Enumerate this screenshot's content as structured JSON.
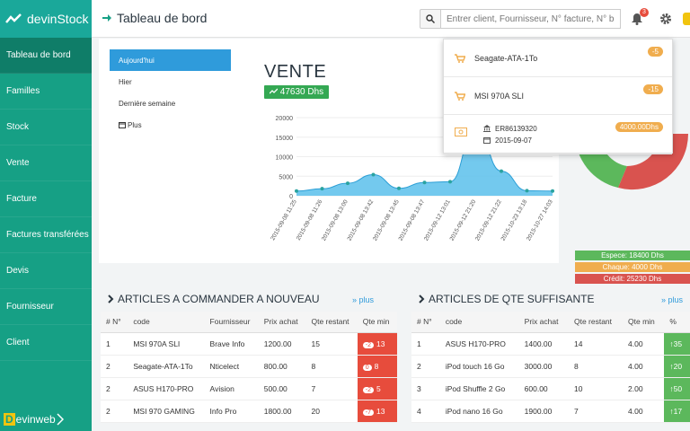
{
  "brand": {
    "name": "devinStock"
  },
  "sidebar": {
    "items": [
      {
        "label": "Tableau de bord"
      },
      {
        "label": "Familles"
      },
      {
        "label": "Stock"
      },
      {
        "label": "Vente"
      },
      {
        "label": "Facture"
      },
      {
        "label": "Factures transférées"
      },
      {
        "label": "Devis"
      },
      {
        "label": "Fournisseur"
      },
      {
        "label": "Client"
      }
    ],
    "footer_logo_d": "D",
    "footer_logo_text": "evinweb"
  },
  "header": {
    "title": "Tableau de bord",
    "search_placeholder": "Entrer client, Fournisseur, N° facture, N° b",
    "notif_count": "3"
  },
  "filters": [
    {
      "label": "Aujourd'hui"
    },
    {
      "label": "Hier"
    },
    {
      "label": "Dernière semaine"
    },
    {
      "label": "Plus"
    }
  ],
  "vente": {
    "title": "VENTE",
    "total": "47630 Dhs"
  },
  "chart_data": {
    "type": "area",
    "x": [
      "2015-09-08 11:25",
      "2015-09-08 11:26",
      "2015-09-08 13:00",
      "2015-09-08 13:42",
      "2015-09-08 13:45",
      "2015-09-08 13:47",
      "2015-09-12 13:01",
      "2015-09-12 21:20",
      "2015-09-12 21:22",
      "2015-10-23 13:18",
      "2015-10-27 14:03"
    ],
    "values": [
      1200,
      1800,
      3200,
      5400,
      1900,
      3400,
      3600,
      17500,
      6300,
      1300,
      1200
    ],
    "yticks": [
      0,
      5000,
      10000,
      15000,
      20000
    ],
    "ylim": [
      0,
      20000
    ],
    "color": "#5bc0eb"
  },
  "donut": {
    "legend": [
      {
        "label": "Espece: 18400 Dhs",
        "color": "#5cb85c"
      },
      {
        "label": "Chaque: 4000 Dhs",
        "color": "#f0ad4e"
      },
      {
        "label": "Crédit: 25230 Dhs",
        "color": "#d9534f"
      }
    ]
  },
  "notifications": [
    {
      "name": "Seagate-ATA-1To",
      "badge": "-5"
    },
    {
      "name": "MSI 970A SLI",
      "badge": "-15"
    },
    {
      "ref": "ER86139320",
      "date": "2015-09-07",
      "amount": "4000.00Dhs"
    }
  ],
  "left_table": {
    "title": "ARTICLES A COMMANDER A NOUVEAU",
    "more": "» plus",
    "headers": [
      "# N°",
      "code",
      "Fournisseur",
      "Prix achat",
      "Qte restant",
      "Qte min"
    ],
    "rows": [
      [
        "1",
        "MSI 970A SLI",
        "Brave Info",
        "1200.00",
        "15",
        "-2",
        "13"
      ],
      [
        "2",
        "Seagate-ATA-1To",
        "Nticelect",
        "800.00",
        "8",
        "0",
        "8"
      ],
      [
        "2",
        "ASUS H170-PRO",
        "Avision",
        "500.00",
        "7",
        "-2",
        "5"
      ],
      [
        "2",
        "MSI 970 GAMING",
        "Info Pro",
        "1800.00",
        "20",
        "-7",
        "13"
      ]
    ]
  },
  "right_table": {
    "title": "ARTICLES DE QTE SUFFISANTE",
    "more": "» plus",
    "headers": [
      "# N°",
      "code",
      "Prix achat",
      "Qte restant",
      "Qte min",
      "%"
    ],
    "rows": [
      [
        "1",
        "ASUS H170-PRO",
        "1400.00",
        "14",
        "4.00",
        "↑35"
      ],
      [
        "2",
        "iPod touch 16 Go",
        "3000.00",
        "8",
        "4.00",
        "↑20"
      ],
      [
        "3",
        "iPod Shuffle 2 Go",
        "600.00",
        "10",
        "2.00",
        "↑50"
      ],
      [
        "4",
        "iPod nano 16 Go",
        "1900.00",
        "7",
        "4.00",
        "↑17"
      ]
    ]
  }
}
